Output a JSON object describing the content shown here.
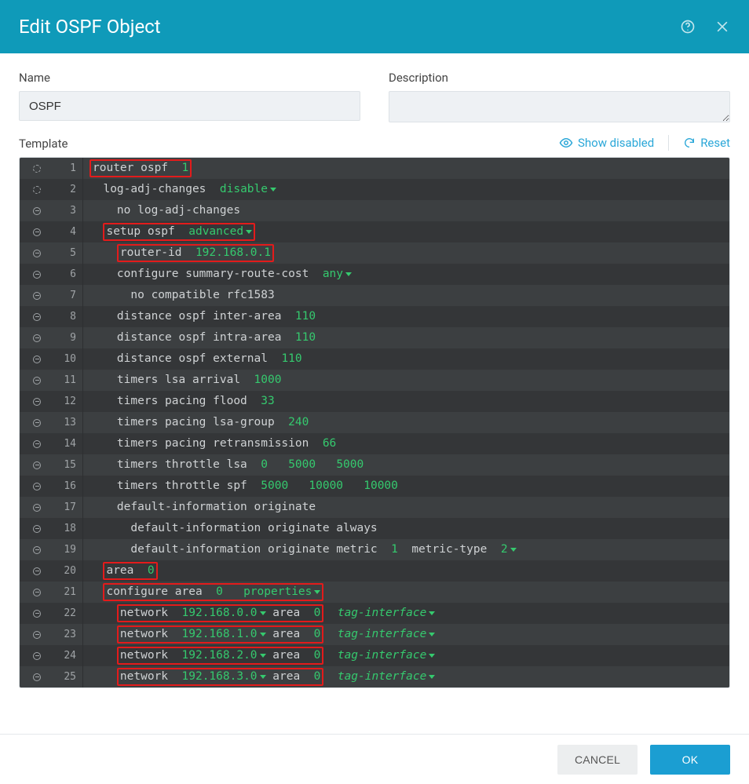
{
  "header": {
    "title": "Edit OSPF Object"
  },
  "form": {
    "name_label": "Name",
    "name_value": "OSPF",
    "desc_label": "Description",
    "desc_value": ""
  },
  "template": {
    "label": "Template",
    "show_disabled": "Show disabled",
    "reset": "Reset"
  },
  "footer": {
    "cancel": "CANCEL",
    "ok": "OK"
  },
  "lines": [
    {
      "n": 1,
      "indent": 0,
      "toggle": "blank",
      "kind": "box",
      "box": [
        [
          "w",
          "router ospf  "
        ],
        [
          "g",
          "1"
        ]
      ]
    },
    {
      "n": 2,
      "indent": 1,
      "toggle": "blank",
      "kind": "plain",
      "seg": [
        [
          "w",
          "log-adj-changes  "
        ],
        [
          "gdd",
          "disable"
        ]
      ]
    },
    {
      "n": 3,
      "indent": 2,
      "toggle": "minus",
      "kind": "plain",
      "seg": [
        [
          "w",
          "no log-adj-changes"
        ]
      ]
    },
    {
      "n": 4,
      "indent": 1,
      "toggle": "minus",
      "kind": "box",
      "box": [
        [
          "w",
          "setup ospf  "
        ],
        [
          "gdd",
          "advanced"
        ]
      ]
    },
    {
      "n": 5,
      "indent": 2,
      "toggle": "minus",
      "kind": "box",
      "box": [
        [
          "w",
          "router-id  "
        ],
        [
          "g",
          "192.168.0.1"
        ]
      ]
    },
    {
      "n": 6,
      "indent": 2,
      "toggle": "minus",
      "kind": "plain",
      "seg": [
        [
          "w",
          "configure summary-route-cost  "
        ],
        [
          "gdd",
          "any"
        ]
      ]
    },
    {
      "n": 7,
      "indent": 3,
      "toggle": "minus",
      "kind": "plain",
      "seg": [
        [
          "w",
          "no compatible rfc1583"
        ]
      ]
    },
    {
      "n": 8,
      "indent": 2,
      "toggle": "minus",
      "kind": "plain",
      "seg": [
        [
          "w",
          "distance ospf inter-area  "
        ],
        [
          "g",
          "110"
        ]
      ]
    },
    {
      "n": 9,
      "indent": 2,
      "toggle": "minus",
      "kind": "plain",
      "seg": [
        [
          "w",
          "distance ospf intra-area  "
        ],
        [
          "g",
          "110"
        ]
      ]
    },
    {
      "n": 10,
      "indent": 2,
      "toggle": "minus",
      "kind": "plain",
      "seg": [
        [
          "w",
          "distance ospf external  "
        ],
        [
          "g",
          "110"
        ]
      ]
    },
    {
      "n": 11,
      "indent": 2,
      "toggle": "minus",
      "kind": "plain",
      "seg": [
        [
          "w",
          "timers lsa arrival  "
        ],
        [
          "g",
          "1000"
        ]
      ]
    },
    {
      "n": 12,
      "indent": 2,
      "toggle": "minus",
      "kind": "plain",
      "seg": [
        [
          "w",
          "timers pacing flood  "
        ],
        [
          "g",
          "33"
        ]
      ]
    },
    {
      "n": 13,
      "indent": 2,
      "toggle": "minus",
      "kind": "plain",
      "seg": [
        [
          "w",
          "timers pacing lsa-group  "
        ],
        [
          "g",
          "240"
        ]
      ]
    },
    {
      "n": 14,
      "indent": 2,
      "toggle": "minus",
      "kind": "plain",
      "seg": [
        [
          "w",
          "timers pacing retransmission  "
        ],
        [
          "g",
          "66"
        ]
      ]
    },
    {
      "n": 15,
      "indent": 2,
      "toggle": "minus",
      "kind": "plain",
      "seg": [
        [
          "w",
          "timers throttle lsa  "
        ],
        [
          "g",
          "0"
        ],
        [
          "w",
          "   "
        ],
        [
          "g",
          "5000"
        ],
        [
          "w",
          "   "
        ],
        [
          "g",
          "5000"
        ]
      ]
    },
    {
      "n": 16,
      "indent": 2,
      "toggle": "minus",
      "kind": "plain",
      "seg": [
        [
          "w",
          "timers throttle spf  "
        ],
        [
          "g",
          "5000"
        ],
        [
          "w",
          "   "
        ],
        [
          "g",
          "10000"
        ],
        [
          "w",
          "   "
        ],
        [
          "g",
          "10000"
        ]
      ]
    },
    {
      "n": 17,
      "indent": 2,
      "toggle": "minus",
      "kind": "plain",
      "seg": [
        [
          "w",
          "default-information originate"
        ]
      ]
    },
    {
      "n": 18,
      "indent": 3,
      "toggle": "minus",
      "kind": "plain",
      "seg": [
        [
          "w",
          "default-information originate always"
        ]
      ]
    },
    {
      "n": 19,
      "indent": 3,
      "toggle": "minus",
      "kind": "plain",
      "seg": [
        [
          "w",
          "default-information originate metric  "
        ],
        [
          "g",
          "1"
        ],
        [
          "w",
          "  metric-type  "
        ],
        [
          "gdd",
          "2"
        ]
      ]
    },
    {
      "n": 20,
      "indent": 1,
      "toggle": "minus",
      "kind": "box",
      "box": [
        [
          "w",
          "area  "
        ],
        [
          "g",
          "0"
        ]
      ]
    },
    {
      "n": 21,
      "indent": 1,
      "toggle": "minus",
      "kind": "box",
      "box": [
        [
          "w",
          "configure area  "
        ],
        [
          "g",
          "0"
        ],
        [
          "w",
          "   "
        ],
        [
          "gdd",
          "properties"
        ]
      ]
    },
    {
      "n": 22,
      "indent": 2,
      "toggle": "minus",
      "kind": "netbox",
      "box": [
        [
          "w",
          "network  "
        ],
        [
          "gdd",
          "192.168.0.0"
        ],
        [
          "w",
          " area  "
        ],
        [
          "g",
          "0"
        ]
      ],
      "trail": "tag-interface"
    },
    {
      "n": 23,
      "indent": 2,
      "toggle": "minus",
      "kind": "netbox",
      "box": [
        [
          "w",
          "network  "
        ],
        [
          "gdd",
          "192.168.1.0"
        ],
        [
          "w",
          " area  "
        ],
        [
          "g",
          "0"
        ]
      ],
      "trail": "tag-interface"
    },
    {
      "n": 24,
      "indent": 2,
      "toggle": "minus",
      "kind": "netbox",
      "box": [
        [
          "w",
          "network  "
        ],
        [
          "gdd",
          "192.168.2.0"
        ],
        [
          "w",
          " area  "
        ],
        [
          "g",
          "0"
        ]
      ],
      "trail": "tag-interface"
    },
    {
      "n": 25,
      "indent": 2,
      "toggle": "minus",
      "kind": "netbox",
      "box": [
        [
          "w",
          "network  "
        ],
        [
          "gdd",
          "192.168.3.0"
        ],
        [
          "w",
          " area  "
        ],
        [
          "g",
          "0"
        ]
      ],
      "trail": "tag-interface"
    }
  ]
}
